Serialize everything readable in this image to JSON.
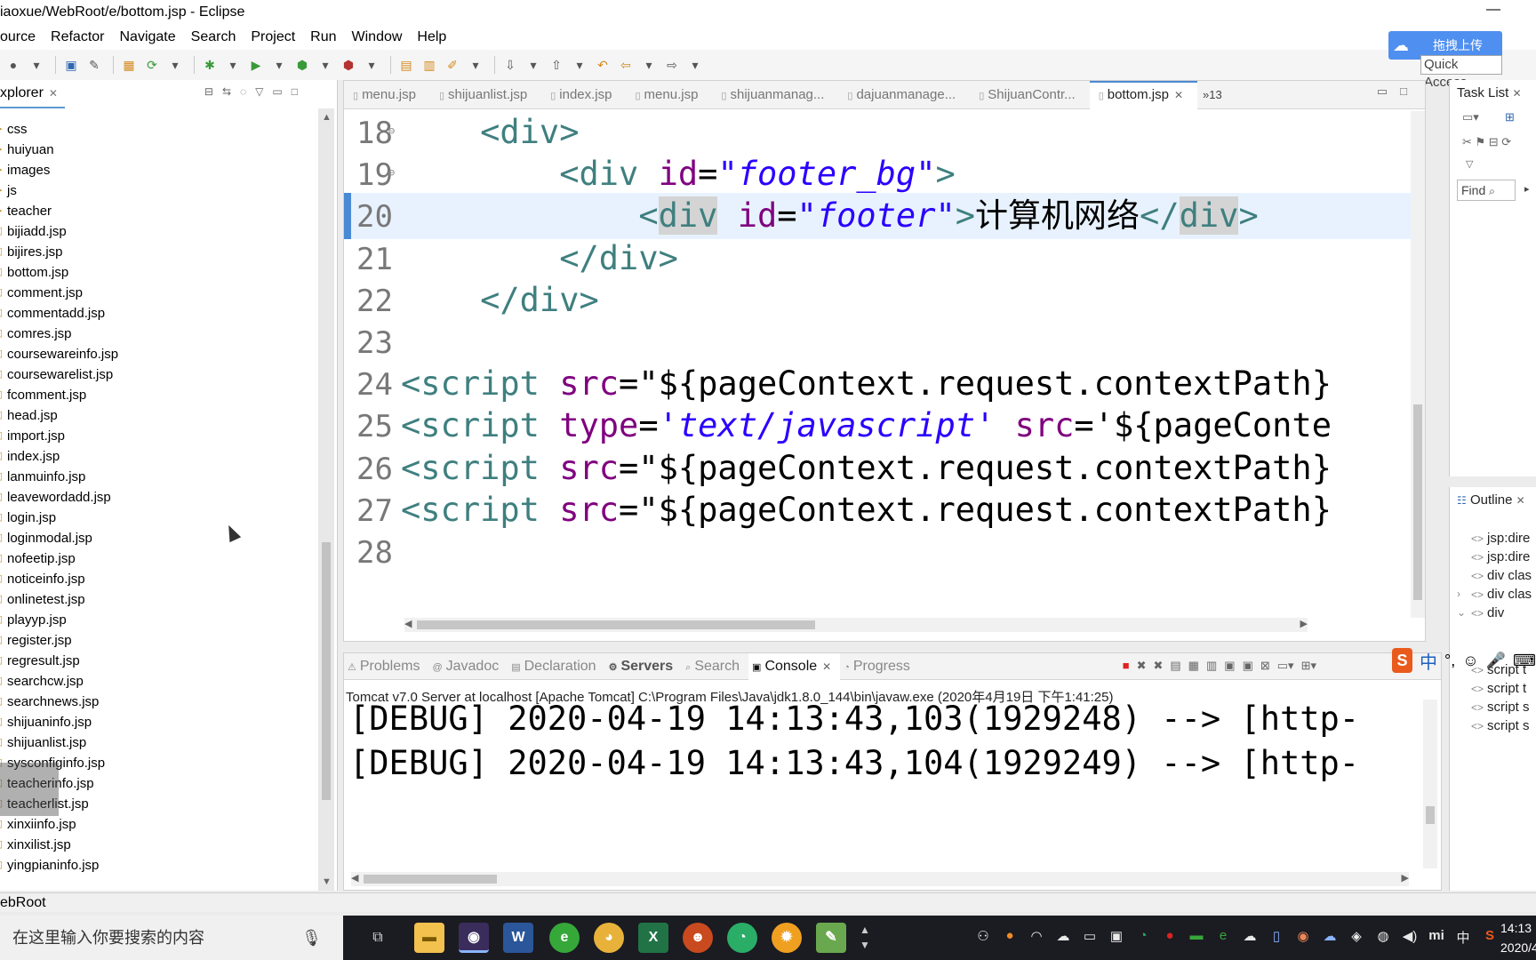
{
  "window": {
    "title": "iaoxue/WebRoot/e/bottom.jsp - Eclipse"
  },
  "menu": [
    "ource",
    "Refactor",
    "Navigate",
    "Search",
    "Project",
    "Run",
    "Window",
    "Help"
  ],
  "toolbar": {
    "baidu_upload": "拖拽上传",
    "quick_access_placeholder": "Quick Access"
  },
  "explorer": {
    "title": "xplorer",
    "items": [
      "css",
      "huiyuan",
      "images",
      "js",
      "teacher",
      "bijiadd.jsp",
      "bijires.jsp",
      "bottom.jsp",
      "comment.jsp",
      "commentadd.jsp",
      "comres.jsp",
      "coursewareinfo.jsp",
      "coursewarelist.jsp",
      "fcomment.jsp",
      "head.jsp",
      "import.jsp",
      "index.jsp",
      "lanmuinfo.jsp",
      "leavewordadd.jsp",
      "login.jsp",
      "loginmodal.jsp",
      "nofeetip.jsp",
      "noticeinfo.jsp",
      "onlinetest.jsp",
      "playyp.jsp",
      "register.jsp",
      "regresult.jsp",
      "searchcw.jsp",
      "searchnews.jsp",
      "shijuaninfo.jsp",
      "shijuanlist.jsp",
      "sysconfiginfo.jsp",
      "teacherinfo.jsp",
      "teacherlist.jsp",
      "xinxiinfo.jsp",
      "xinxilist.jsp",
      "yingpianinfo.jsp"
    ]
  },
  "editor": {
    "tabs": [
      "menu.jsp",
      "shijuanlist.jsp",
      "index.jsp",
      "menu.jsp",
      "shijuanmanag...",
      "dajuanmanage...",
      "ShijuanContr...",
      "bottom.jsp"
    ],
    "active_tab": "bottom.jsp",
    "more_tabs": "»13",
    "lines": [
      {
        "n": "18",
        "tokens": [
          {
            "c": "ws",
            "t": "    "
          },
          {
            "c": "tag",
            "t": "<div>"
          }
        ]
      },
      {
        "n": "19",
        "tokens": [
          {
            "c": "ws",
            "t": "        "
          },
          {
            "c": "tag",
            "t": "<div "
          },
          {
            "c": "attr",
            "t": "id"
          },
          {
            "c": "txt",
            "t": "="
          },
          {
            "c": "str",
            "t": "\"footer_bg\""
          },
          {
            "c": "tag",
            "t": ">"
          }
        ]
      },
      {
        "n": "20",
        "tokens": [
          {
            "c": "ws",
            "t": "            "
          },
          {
            "c": "tag",
            "t": "<"
          },
          {
            "c": "tag hl",
            "t": "div"
          },
          {
            "c": "tag",
            "t": " "
          },
          {
            "c": "attr",
            "t": "id"
          },
          {
            "c": "txt",
            "t": "="
          },
          {
            "c": "str",
            "t": "\"footer\""
          },
          {
            "c": "tag",
            "t": ">"
          },
          {
            "c": "txt",
            "t": "计算机网络"
          },
          {
            "c": "tag",
            "t": "</"
          },
          {
            "c": "tag hl",
            "t": "div"
          },
          {
            "c": "tag",
            "t": ">"
          }
        ]
      },
      {
        "n": "21",
        "tokens": [
          {
            "c": "ws",
            "t": "        "
          },
          {
            "c": "tag",
            "t": "</div>"
          }
        ]
      },
      {
        "n": "22",
        "tokens": [
          {
            "c": "ws",
            "t": "    "
          },
          {
            "c": "tag",
            "t": "</div>"
          }
        ]
      },
      {
        "n": "23",
        "tokens": []
      },
      {
        "n": "24",
        "tokens": [
          {
            "c": "tag",
            "t": "<script "
          },
          {
            "c": "attr",
            "t": "src"
          },
          {
            "c": "txt",
            "t": "=\"${pageContext.request.contextPath}"
          }
        ]
      },
      {
        "n": "25",
        "tokens": [
          {
            "c": "tag",
            "t": "<script "
          },
          {
            "c": "attr",
            "t": "type"
          },
          {
            "c": "txt",
            "t": "="
          },
          {
            "c": "str",
            "t": "'text/javascript'"
          },
          {
            "c": "tag",
            "t": " "
          },
          {
            "c": "attr",
            "t": "src"
          },
          {
            "c": "txt",
            "t": "='${pageConte"
          }
        ]
      },
      {
        "n": "26",
        "tokens": [
          {
            "c": "tag",
            "t": "<script "
          },
          {
            "c": "attr",
            "t": "src"
          },
          {
            "c": "txt",
            "t": "=\"${pageContext.request.contextPath}"
          }
        ]
      },
      {
        "n": "27",
        "tokens": [
          {
            "c": "tag",
            "t": "<script "
          },
          {
            "c": "attr",
            "t": "src"
          },
          {
            "c": "txt",
            "t": "=\"${pageContext.request.contextPath}"
          }
        ]
      },
      {
        "n": "28",
        "tokens": []
      }
    ],
    "current_line": "20"
  },
  "task_list": {
    "title": "Task List",
    "find_placeholder": "Find"
  },
  "outline": {
    "title": "Outline",
    "items": [
      "jsp:dire",
      "jsp:dire",
      "div clas",
      "div clas",
      "div",
      "script t",
      "script t",
      "script s",
      "script s"
    ]
  },
  "console": {
    "tabs": [
      "Problems",
      "Javadoc",
      "Declaration",
      "Servers",
      "Search",
      "Console",
      "Progress"
    ],
    "active_tab": "Console",
    "server_line": "Tomcat v7.0 Server at localhost [Apache Tomcat] C:\\Program Files\\Java\\jdk1.8.0_144\\bin\\javaw.exe (2020年4月19日 下午1:41:25)",
    "log_lines": [
      "[DEBUG] 2020-04-19 14:13:43,103(1929248) --> [http-",
      "[DEBUG] 2020-04-19 14:13:43,104(1929249) --> [http-"
    ]
  },
  "ime": {
    "logo": "S",
    "mode": "中"
  },
  "statusbar": {
    "text": "ebRoot"
  },
  "taskbar": {
    "search_placeholder": "在这里输入你要搜索的内容",
    "apps": [
      "W",
      "X"
    ],
    "tray_lang": "中",
    "tray_mi": "mi",
    "clock_time": "14:13",
    "clock_date": "2020/4"
  },
  "colors": {
    "accent": "#4a8ad4",
    "tag": "#3f7f7f",
    "attr": "#7f007f",
    "string": "#2a00ff",
    "current_line": "#e8f2fe"
  }
}
